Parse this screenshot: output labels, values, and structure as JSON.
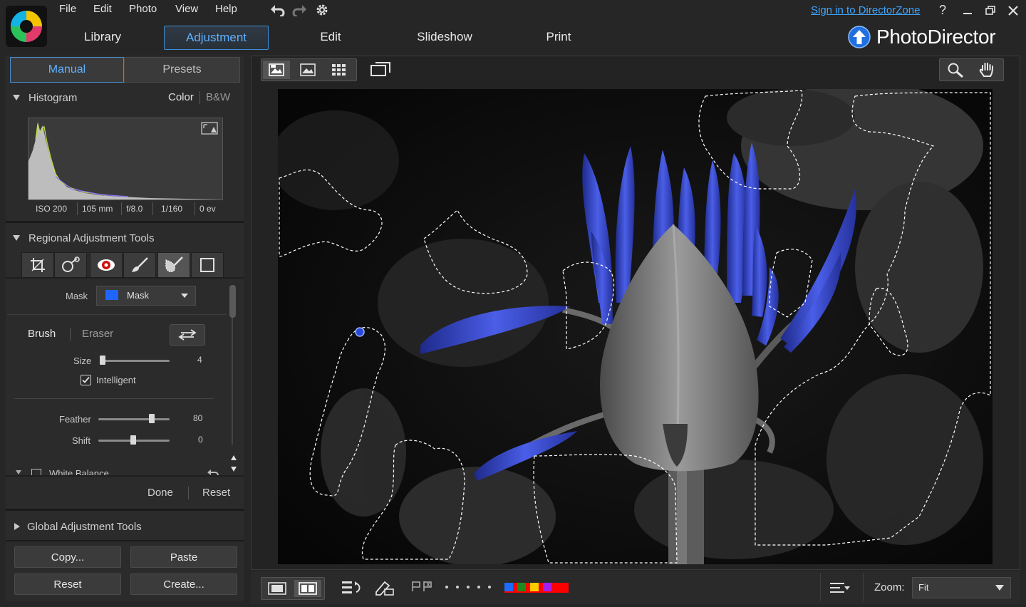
{
  "menu": {
    "file": "File",
    "edit": "Edit",
    "photo": "Photo",
    "view": "View",
    "help": "Help"
  },
  "top": {
    "sign_in": "Sign in to DirectorZone",
    "help_glyph": "?"
  },
  "modes": {
    "library": "Library",
    "adjustment": "Adjustment",
    "edit": "Edit",
    "slideshow": "Slideshow",
    "print": "Print"
  },
  "brand": {
    "name": "PhotoDirector"
  },
  "panel": {
    "tabs": {
      "manual": "Manual",
      "presets": "Presets"
    },
    "histogram": {
      "title": "Histogram",
      "color": "Color",
      "bw": "B&W",
      "exif": {
        "iso": "ISO 200",
        "focal": "105 mm",
        "aperture": "f/8.0",
        "shutter": "1/160",
        "ev": "0 ev"
      }
    },
    "regional": {
      "title": "Regional Adjustment Tools",
      "mask_label": "Mask",
      "mask_value": "Mask",
      "mask_color": "#1e66ff",
      "brush": "Brush",
      "eraser": "Eraser",
      "size_label": "Size",
      "size_value": "4",
      "intelligent": "Intelligent",
      "feather_label": "Feather",
      "feather_value": "80",
      "shift_label": "Shift",
      "shift_value": "0",
      "white_balance": "White Balance",
      "done": "Done",
      "reset": "Reset"
    },
    "global": {
      "title": "Global Adjustment Tools"
    },
    "buttons": {
      "copy": "Copy...",
      "paste": "Paste",
      "reset": "Reset",
      "create": "Create..."
    }
  },
  "bottom": {
    "zoom_label": "Zoom:",
    "zoom_value": "Fit",
    "color_labels": [
      "#ff0000",
      "#1e6bff",
      "#1e8a1e",
      "#ffcc00",
      "#a020f0"
    ]
  }
}
